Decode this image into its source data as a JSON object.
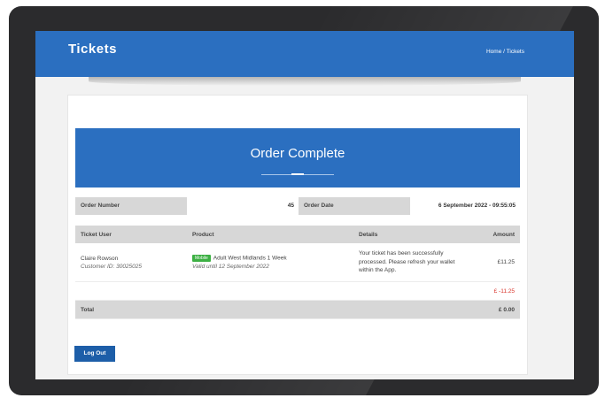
{
  "header": {
    "title": "Tickets",
    "breadcrumb_home": "Home",
    "breadcrumb_separator": "/",
    "breadcrumb_current": "Tickets"
  },
  "banner": {
    "heading": "Order Complete"
  },
  "order": {
    "number_label": "Order Number",
    "number_value": "45",
    "date_label": "Order Date",
    "date_value": "6 September 2022 - 09:55:05"
  },
  "table": {
    "headers": {
      "user": "Ticket User",
      "product": "Product",
      "details": "Details",
      "amount": "Amount"
    },
    "row": {
      "user_name": "Claire Rowson",
      "customer_id": "Customer ID: 30025025",
      "badge": "Mobile",
      "product_name": "Adult West Midlands 1 Week",
      "valid_until": "Valid until 12 September 2022",
      "details": "Your ticket has been successfully processed. Please refresh your wallet within the App.",
      "amount": "£11.25"
    },
    "discount_amount": "£ -11.25",
    "total_label": "Total",
    "total_amount": "£ 0.00"
  },
  "actions": {
    "logout_label": "Log Out"
  },
  "colors": {
    "header_blue": "#2b6fc0",
    "button_blue": "#1d5ea8",
    "badge_green": "#3cb043",
    "negative_red": "#d9342b"
  }
}
